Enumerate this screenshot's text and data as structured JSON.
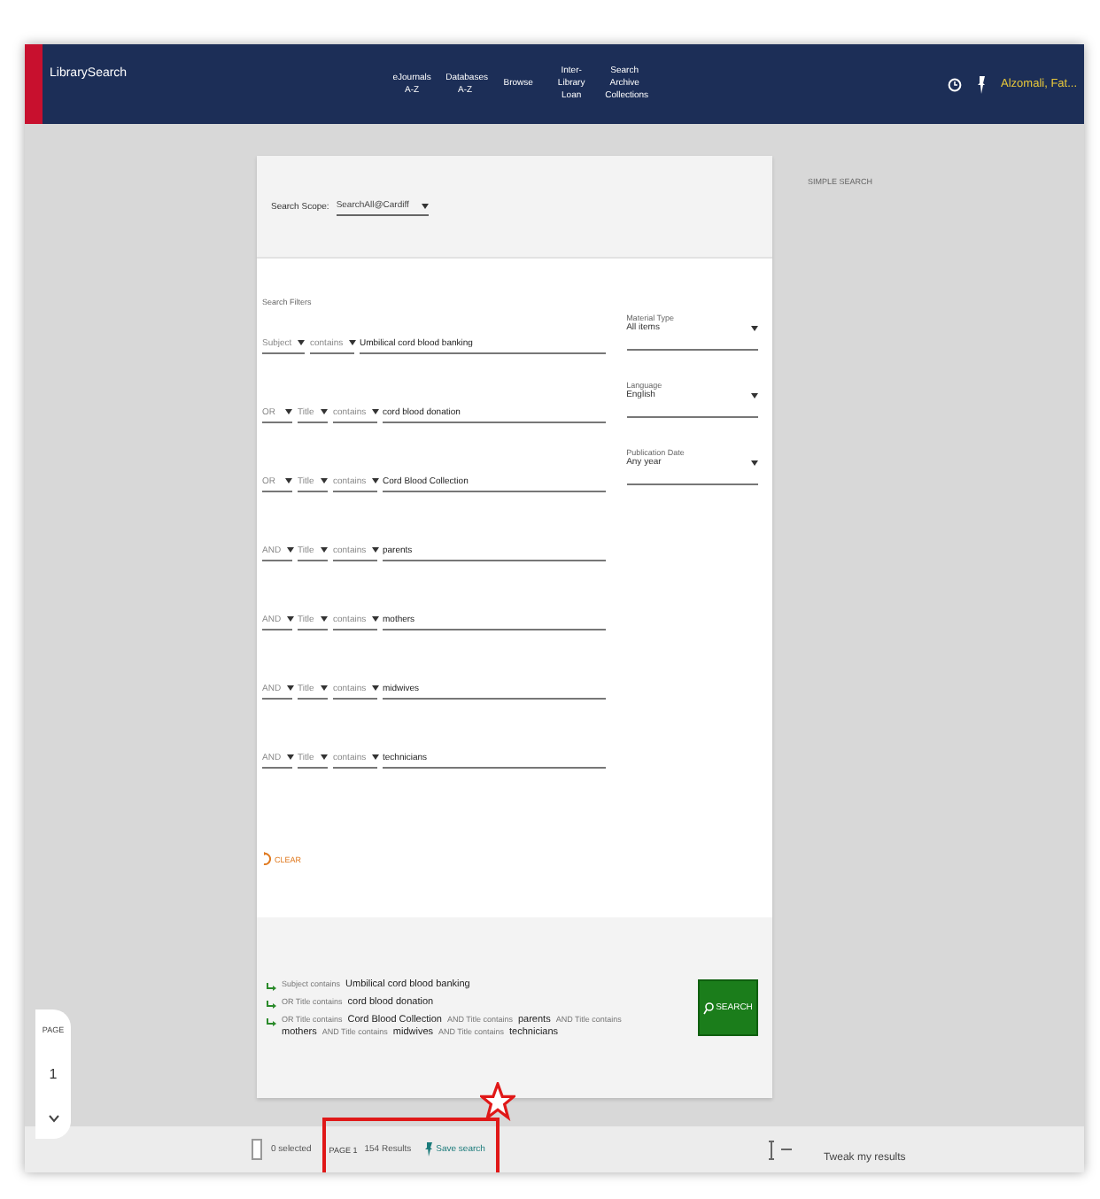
{
  "header": {
    "logo_text": "LibrarySearch",
    "nav": [
      "eJournals A-Z",
      "Databases A-Z",
      "Browse",
      "Inter-Library Loan",
      "Search Archive Collections"
    ],
    "user": "Alzomali, Fat..."
  },
  "scope": {
    "label": "Search Scope:",
    "value": "SearchAll@Cardiff"
  },
  "filters": {
    "title": "Search Filters",
    "rows": [
      {
        "field": "Subject",
        "condition": "contains",
        "value": "Umbilical cord blood banking"
      },
      {
        "operator": "OR",
        "field": "Title",
        "condition": "contains",
        "value": "cord blood donation"
      },
      {
        "operator": "OR",
        "field": "Title",
        "condition": "contains",
        "value": "Cord Blood Collection"
      },
      {
        "operator": "AND",
        "field": "Title",
        "condition": "contains",
        "value": "parents"
      },
      {
        "operator": "AND",
        "field": "Title",
        "condition": "contains",
        "value": "mothers"
      },
      {
        "operator": "AND",
        "field": "Title",
        "condition": "contains",
        "value": "midwives"
      },
      {
        "operator": "AND",
        "field": "Title",
        "condition": "contains",
        "value": "technicians"
      }
    ],
    "side": [
      {
        "label": "Material Type",
        "value": "All items"
      },
      {
        "label": "Language",
        "value": "English"
      },
      {
        "label": "Publication Date",
        "value": "Any year"
      }
    ],
    "clear": "CLEAR"
  },
  "summary": [
    {
      "parts": [
        {
          "prefix": "Subject contains",
          "term": "Umbilical cord blood banking"
        }
      ]
    },
    {
      "parts": [
        {
          "prefix": "OR Title contains",
          "term": "cord blood donation"
        }
      ]
    },
    {
      "parts": [
        {
          "prefix": "OR Title contains",
          "term": "Cord Blood Collection"
        },
        {
          "prefix": "AND Title contains",
          "term": "parents"
        },
        {
          "prefix": "AND Title contains",
          "term": "mothers"
        },
        {
          "prefix": "AND Title contains",
          "term": "midwives"
        },
        {
          "prefix": "AND Title contains",
          "term": "technicians"
        }
      ]
    }
  ],
  "search_button": "SEARCH",
  "simple_search": "SIMPLE SEARCH",
  "pager": {
    "label": "PAGE",
    "number": "1"
  },
  "results_bar": {
    "checked": false,
    "selected": "0 selected",
    "page": "PAGE 1",
    "results": "154 Results",
    "save": "Save search",
    "tweak": "Tweak my results"
  }
}
